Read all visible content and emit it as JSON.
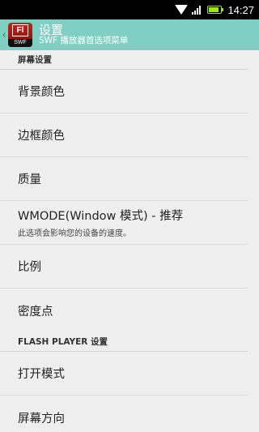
{
  "status_bar": {
    "time": "14:27",
    "icons": [
      "wifi-icon",
      "signal-icon",
      "battery-icon"
    ],
    "battery_level": 0.9,
    "battery_color": "#9be21f"
  },
  "action_bar": {
    "title": "设置",
    "subtitle": "SWF 播放器首选项菜单",
    "background": "#7fd0c2",
    "app_icon": {
      "top_text": "Fl",
      "bottom_text": "SWF"
    }
  },
  "sections": [
    {
      "header": "屏幕设置",
      "items": [
        {
          "title": "背景颜色"
        },
        {
          "title": "边框颜色"
        },
        {
          "title": "质量"
        },
        {
          "title": "WMODE(Window 模式) - 推荐",
          "summary": "此选项会影响您的设备的速度。"
        },
        {
          "title": "比例"
        },
        {
          "title": "密度点"
        }
      ]
    },
    {
      "header": "FLASH PLAYER 设置",
      "items": [
        {
          "title": "打开模式"
        },
        {
          "title": "屏幕方向"
        }
      ]
    }
  ]
}
